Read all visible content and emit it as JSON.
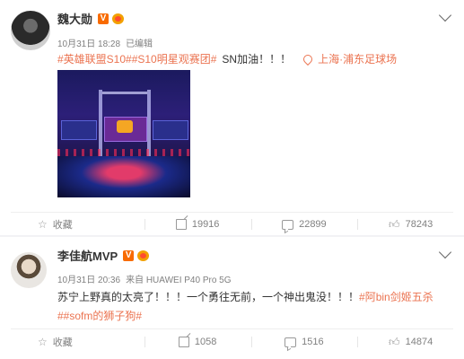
{
  "post1": {
    "author": "魏大勋",
    "verified_badge": "V",
    "medal_icon": "fan-medal-icon",
    "meta": {
      "time": "10月31日 18:28",
      "edited": "已编辑"
    },
    "text": {
      "tag1": "#英雄联盟S10#",
      "tag2": "#S10明星观赛团#",
      "plain": "SN加油！！！",
      "location": "上海·浦东足球场"
    },
    "image_desc_icon": "stage-photo",
    "actions": {
      "favorite": "收藏",
      "share": "19916",
      "comment": "22899",
      "like": "78243"
    }
  },
  "post2": {
    "author": "李佳航MVP",
    "verified_badge": "V",
    "medal_icon": "fan-medal-icon",
    "meta": {
      "time": "10月31日 20:36",
      "source": "来自 HUAWEI P40 Pro 5G"
    },
    "text": {
      "line1_plain": "苏宁上野真的太亮了！！！一个勇往无前，一个神出鬼没！！！",
      "line1_tag": "#阿bin剑姬五杀",
      "line2_tag": "##sofm的狮子狗#"
    },
    "actions": {
      "favorite": "收藏",
      "share": "1058",
      "comment": "1516",
      "like": "14874"
    }
  },
  "colors": {
    "link": "#eb7350",
    "verified": "#f86b00",
    "muted": "#808080"
  }
}
